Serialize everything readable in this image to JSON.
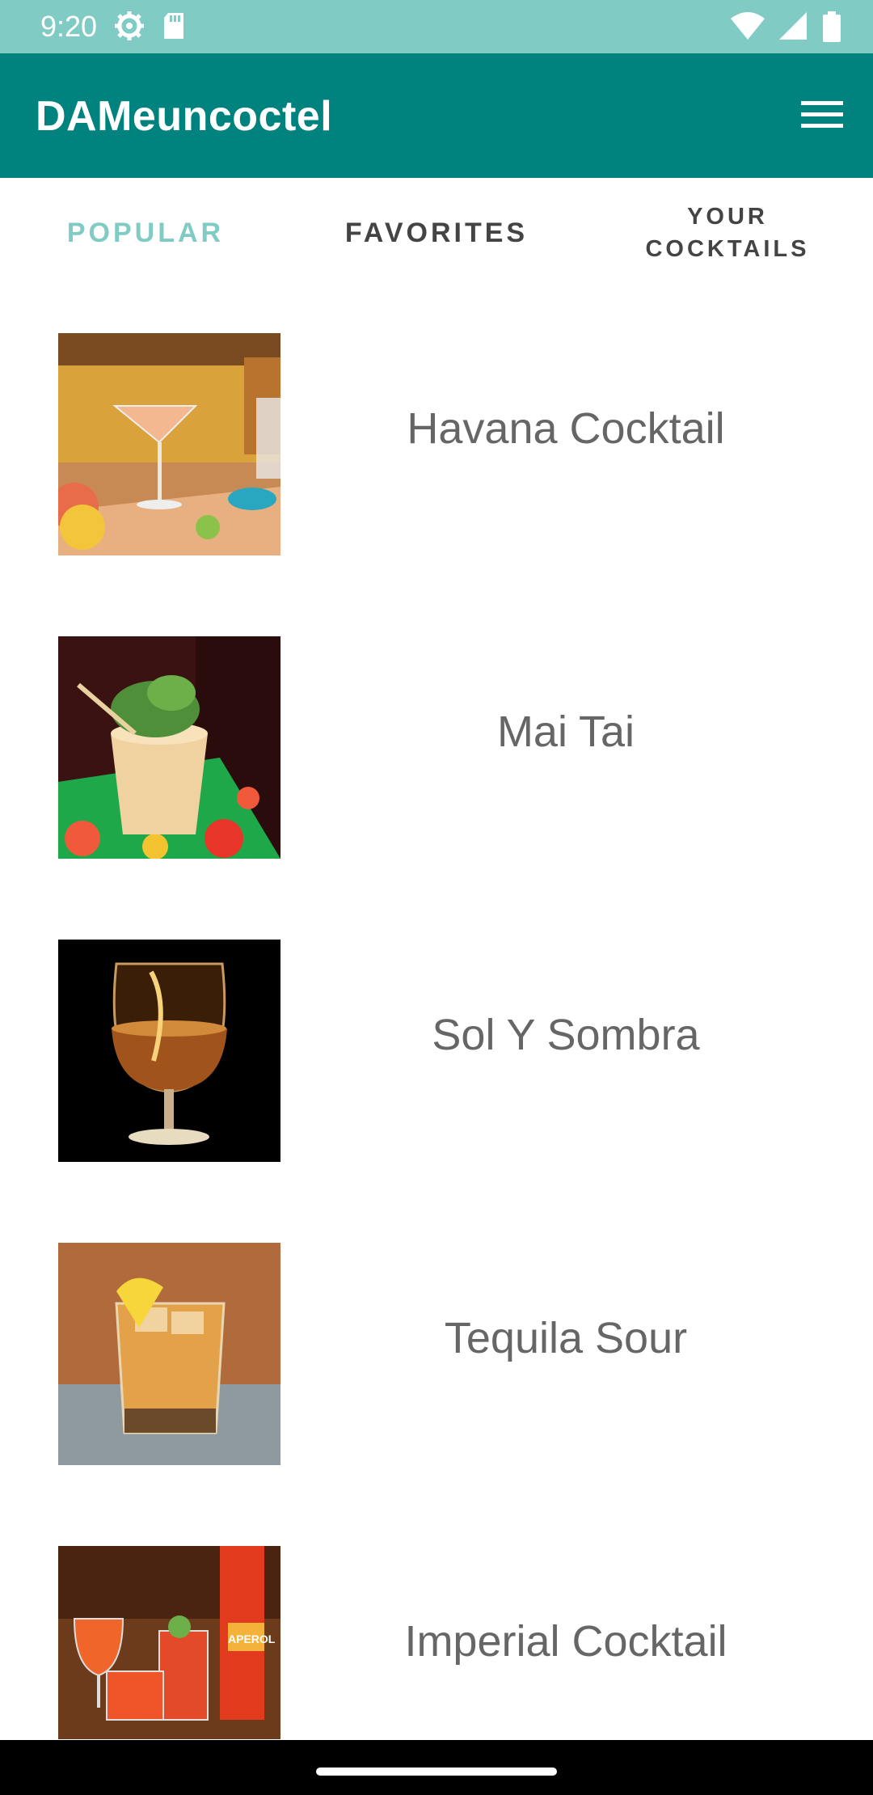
{
  "status_bar": {
    "time": "9:20",
    "icons_left": [
      "settings-gear-icon",
      "sd-card-icon"
    ],
    "icons_right": [
      "wifi-icon",
      "cell-signal-icon",
      "battery-icon"
    ],
    "color": "#80cbc4"
  },
  "app_bar": {
    "title": "DAMeuncoctel",
    "menu_icon": "hamburger-menu-icon",
    "color": "#00837f"
  },
  "tabs": [
    {
      "label": "POPULAR",
      "active": true
    },
    {
      "label": "FAVORITES",
      "active": false
    },
    {
      "label": "YOUR COCKTAILS",
      "active": false
    }
  ],
  "accent_color": "#80cbc4",
  "cocktails": [
    {
      "name": "Havana Cocktail",
      "image": "havana-cocktail-photo"
    },
    {
      "name": "Mai Tai",
      "image": "mai-tai-photo"
    },
    {
      "name": "Sol Y Sombra",
      "image": "sol-y-sombra-photo"
    },
    {
      "name": "Tequila Sour",
      "image": "tequila-sour-photo"
    },
    {
      "name": "Imperial Cocktail",
      "image": "imperial-cocktail-photo"
    }
  ]
}
